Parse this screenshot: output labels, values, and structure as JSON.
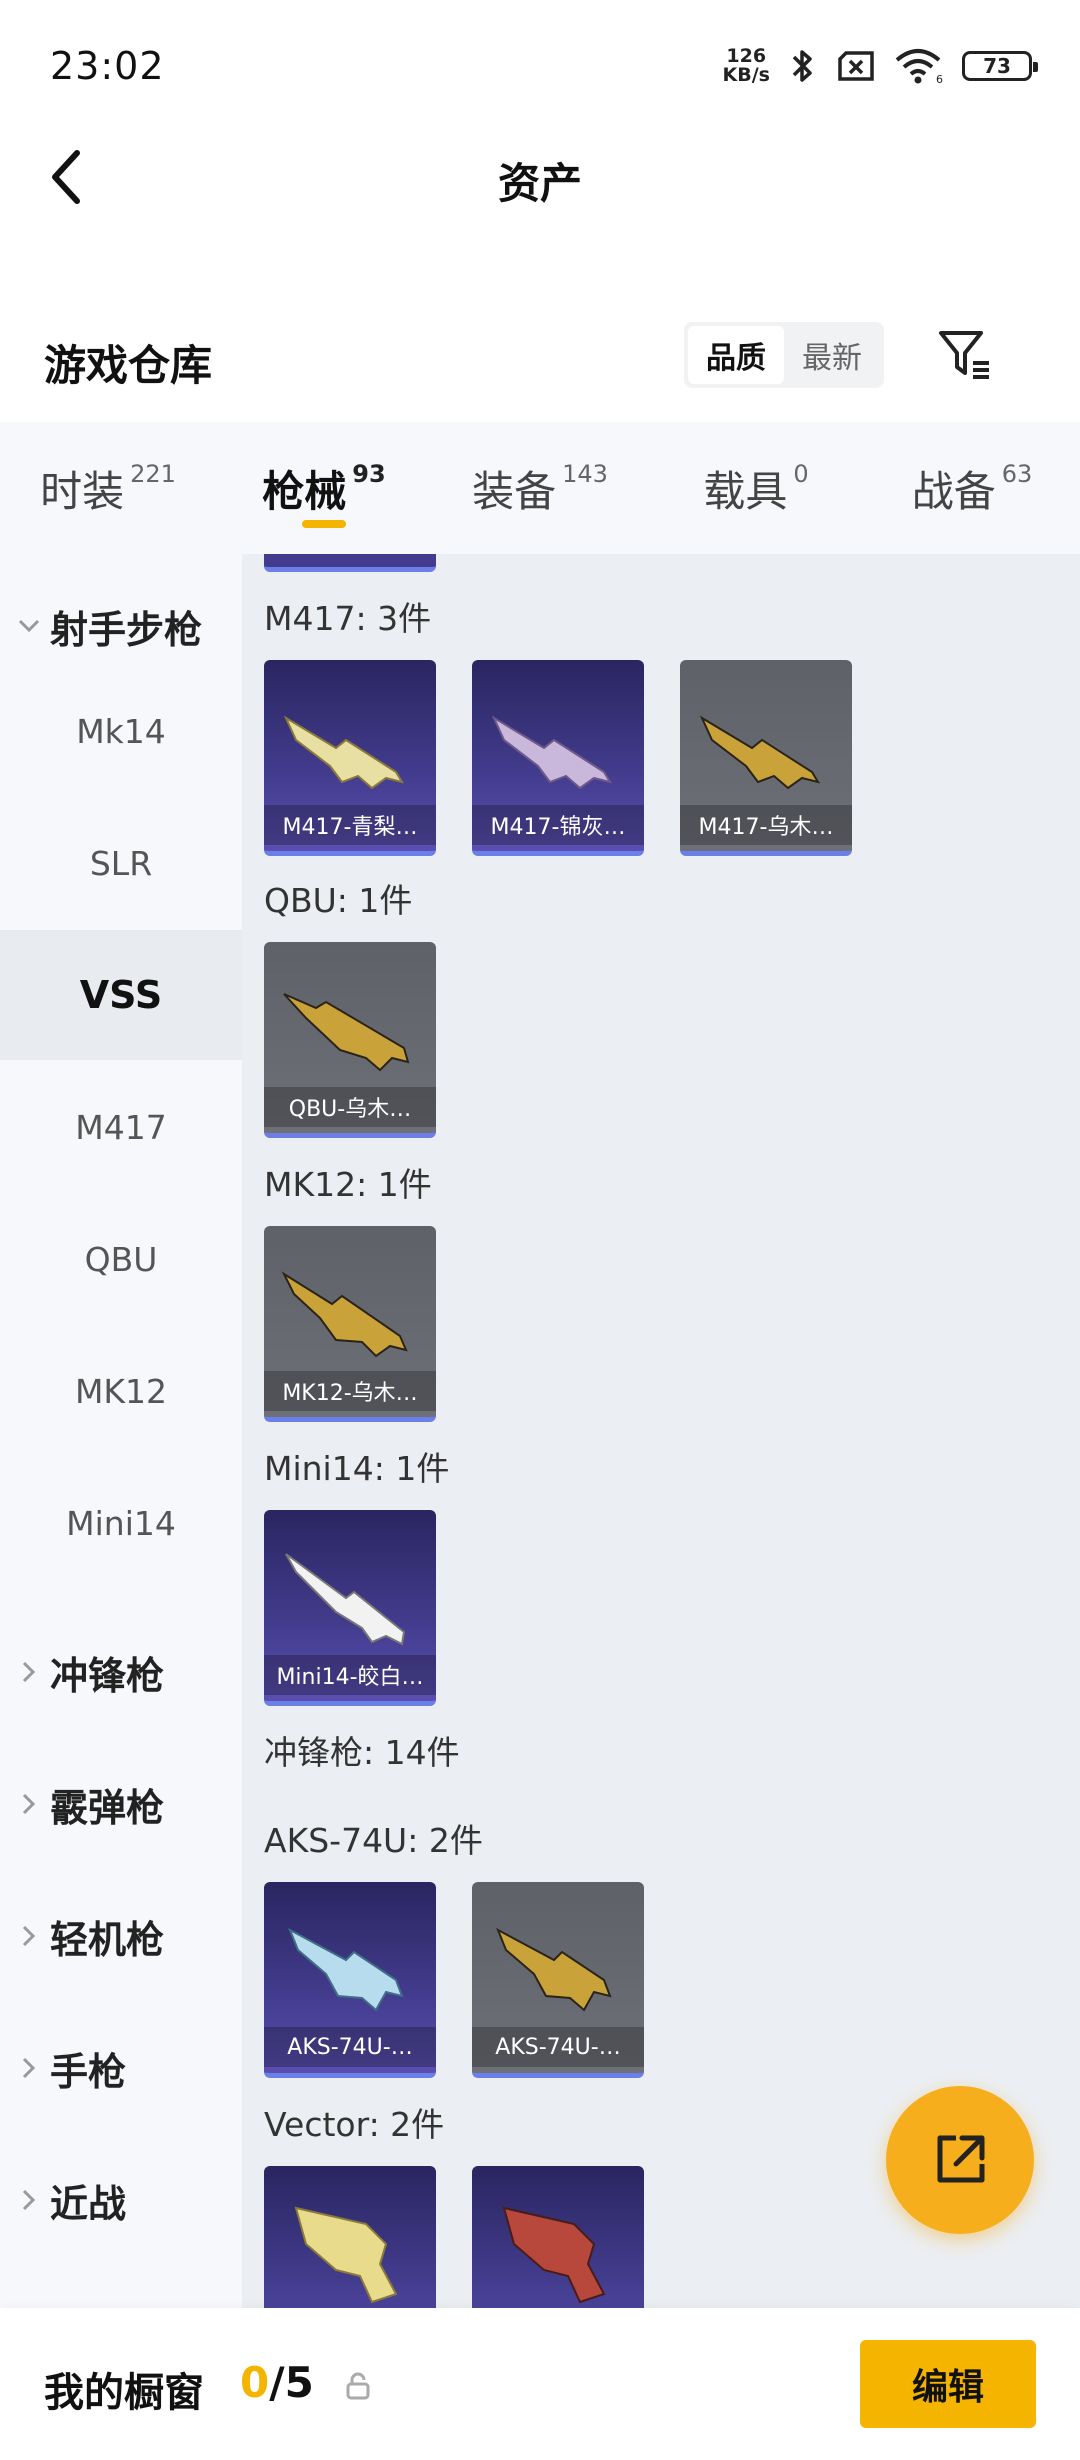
{
  "status": {
    "time": "23:02",
    "net_speed_value": "126",
    "net_speed_unit": "KB/s",
    "battery": "73"
  },
  "header": {
    "title": "资产"
  },
  "warehouse": {
    "title": "游戏仓库",
    "sort_options": [
      "品质",
      "最新"
    ],
    "sort_selected": "品质"
  },
  "tabs": [
    {
      "label": "时装",
      "count": "221"
    },
    {
      "label": "枪械",
      "count": "93",
      "active": true
    },
    {
      "label": "装备",
      "count": "143"
    },
    {
      "label": "载具",
      "count": "0"
    },
    {
      "label": "战备",
      "count": "63"
    }
  ],
  "sidebar": {
    "group_open": "射手步枪",
    "items": [
      "Mk14",
      "SLR",
      "VSS",
      "M417",
      "QBU",
      "MK12",
      "Mini14"
    ],
    "selected": "VSS",
    "groups_closed": [
      "冲锋枪",
      "霰弹枪",
      "轻机枪",
      "手枪",
      "近战"
    ]
  },
  "content": {
    "sections": [
      {
        "title": "M417: 3件",
        "items": [
          {
            "name": "M417-青梨…",
            "rarity": "purple",
            "icon": "rifle-icon"
          },
          {
            "name": "M417-锦灰…",
            "rarity": "purple",
            "icon": "rifle-icon"
          },
          {
            "name": "M417-乌木…",
            "rarity": "gray",
            "icon": "rifle-icon"
          }
        ]
      },
      {
        "title": "QBU: 1件",
        "items": [
          {
            "name": "QBU-乌木…",
            "rarity": "gray",
            "icon": "rifle-icon"
          }
        ]
      },
      {
        "title": "MK12: 1件",
        "items": [
          {
            "name": "MK12-乌木…",
            "rarity": "gray",
            "icon": "rifle-icon"
          }
        ]
      },
      {
        "title": "Mini14: 1件",
        "items": [
          {
            "name": "Mini14-皎白…",
            "rarity": "purple",
            "icon": "rifle-icon"
          }
        ]
      }
    ],
    "category_title": "冲锋枪: 14件",
    "sub_sections": [
      {
        "title": "AKS-74U: 2件",
        "items": [
          {
            "name": "AKS-74U-…",
            "rarity": "purple",
            "icon": "smg-icon"
          },
          {
            "name": "AKS-74U-…",
            "rarity": "gray",
            "icon": "smg-icon"
          }
        ]
      },
      {
        "title": "Vector: 2件",
        "items": [
          {
            "name": "",
            "rarity": "purple",
            "icon": "smg-icon"
          },
          {
            "name": "",
            "rarity": "purple",
            "icon": "smg-icon"
          }
        ]
      }
    ]
  },
  "bottom": {
    "label": "我的橱窗",
    "count_current": "0",
    "count_total": "/5",
    "edit_label": "编辑"
  },
  "colors": {
    "accent": "#f5b400",
    "fab": "#f7ae1c",
    "purple_card": "#433c8e",
    "gray_card": "#6e7078",
    "rarity_bar": "#6c7ee8"
  }
}
